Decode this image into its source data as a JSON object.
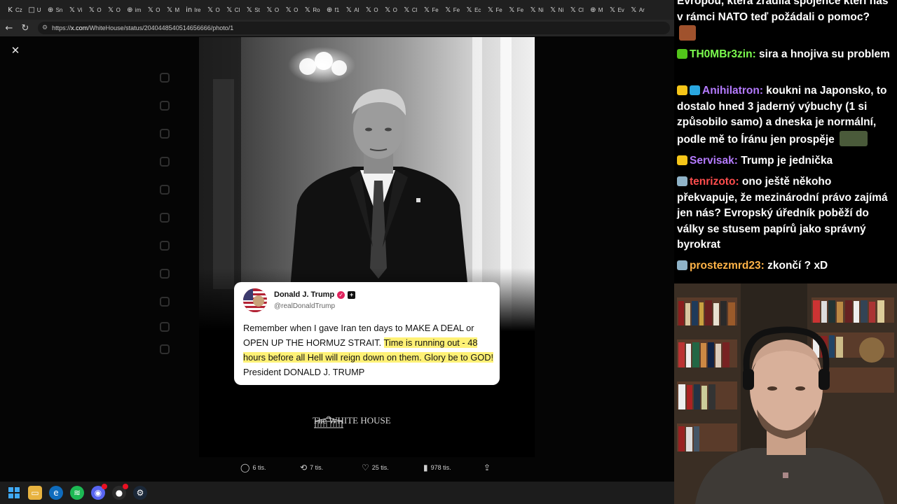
{
  "browser": {
    "tabs": [
      {
        "icon": "K",
        "label": "Cz"
      },
      {
        "icon": "□",
        "label": "U"
      },
      {
        "icon": "⊕",
        "label": "Sn"
      },
      {
        "icon": "𝕏",
        "label": "Vi"
      },
      {
        "icon": "𝕏",
        "label": "O"
      },
      {
        "icon": "𝕏",
        "label": "O"
      },
      {
        "icon": "⊕",
        "label": "im"
      },
      {
        "icon": "𝕏",
        "label": "O"
      },
      {
        "icon": "𝕏",
        "label": "M"
      },
      {
        "icon": "in",
        "label": "Ire"
      },
      {
        "icon": "𝕏",
        "label": "O"
      },
      {
        "icon": "𝕏",
        "label": "Cl"
      },
      {
        "icon": "𝕏",
        "label": "St"
      },
      {
        "icon": "𝕏",
        "label": "O"
      },
      {
        "icon": "𝕏",
        "label": "O"
      },
      {
        "icon": "𝕏",
        "label": "Ro"
      },
      {
        "icon": "⊕",
        "label": "f1"
      },
      {
        "icon": "𝕏",
        "label": "Al"
      },
      {
        "icon": "𝕏",
        "label": "O"
      },
      {
        "icon": "𝕏",
        "label": "O"
      },
      {
        "icon": "𝕏",
        "label": "Cl"
      },
      {
        "icon": "𝕏",
        "label": "Fe"
      },
      {
        "icon": "𝕏",
        "label": "Fe"
      },
      {
        "icon": "𝕏",
        "label": "Ec"
      },
      {
        "icon": "𝕏",
        "label": "Fe"
      },
      {
        "icon": "𝕏",
        "label": "Fe"
      },
      {
        "icon": "𝕏",
        "label": "Ni"
      },
      {
        "icon": "𝕏",
        "label": "Ni"
      },
      {
        "icon": "𝕏",
        "label": "Cl"
      },
      {
        "icon": "⊕",
        "label": "M"
      },
      {
        "icon": "𝕏",
        "label": "Ev"
      },
      {
        "icon": "𝕏",
        "label": "Ar"
      }
    ],
    "url_prefix": "https://",
    "url_host": "x.com",
    "url_path": "/WhiteHouse/status/2040448540514656666/photo/1"
  },
  "post": {
    "author_name": "Donald J. Trump",
    "author_handle": "@realDonaldTrump",
    "text_plain": "Remember when I gave Iran ten days to MAKE A DEAL or OPEN UP THE HORMUZ STRAIT. ",
    "text_highlight": "Time is running out - 48 hours before all Hell will reign down on them. Glory be to GOD!",
    "text_end": " President DONALD J. TRUMP",
    "watermark": "The WHITE HOUSE",
    "replies": "6 tis.",
    "reposts": "7 tis.",
    "likes": "25 tis.",
    "views": "978 tis."
  },
  "chat": {
    "messages": [
      {
        "user": "",
        "color": "#ffffff",
        "text": "Evropou, která zradila spojence kteří nás v rámci NATO teď požádali o pomoc?",
        "emote": true
      },
      {
        "user": "TH0MBr3zin",
        "color": "#7cfc4f",
        "text": "sira a hnojiva su problem",
        "emote": false
      },
      {
        "user": "Anihilatron",
        "color": "#b57bff",
        "text": "koukni na Japonsko, to dostalo hned 3 jaderný výbuchy (1 si způsobilo samo) a dneska je normální, podle mě to Íránu jen prospěje",
        "emote": true
      },
      {
        "user": "Servisak",
        "color": "#b57bff",
        "text": "Trump je jednička",
        "emote": false
      },
      {
        "user": "tenrizoto",
        "color": "#ff4d4d",
        "text": "ono ještě někoho překvapuje, že mezinárodní právo zajímá jen nás? Evropský úředník poběží do války se stusem papírů jako správný byrokrat",
        "emote": false
      },
      {
        "user": "prostezmrd23",
        "color": "#ffb347",
        "text": "zkončí ? xD",
        "emote": false
      }
    ]
  }
}
